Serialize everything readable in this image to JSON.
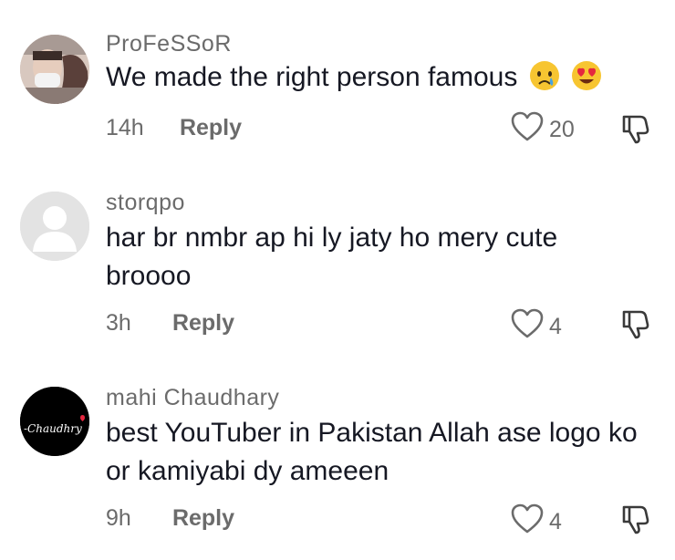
{
  "comments": [
    {
      "username": "ProFeSSoR",
      "text": "We made the right person famous",
      "emojis": [
        "crying-face",
        "heart-eyes-face"
      ],
      "time": "14h",
      "reply_label": "Reply",
      "likes": "20",
      "avatar": "photo"
    },
    {
      "username": "storqpo",
      "text": "har br nmbr ap hi ly jaty ho mery cute broooo",
      "time": "3h",
      "reply_label": "Reply",
      "likes": "4",
      "avatar": "default"
    },
    {
      "username": "mahi Chaudhary",
      "text": "best YouTuber in Pakistan Allah ase logo ko or kamiyabi dy ameeen",
      "time": "9h",
      "reply_label": "Reply",
      "likes": "4",
      "avatar": "logo",
      "avatar_text": "-Chaudhry"
    }
  ],
  "icons": {
    "like": "heart-outline-icon",
    "dislike": "thumbs-down-outline-icon"
  },
  "colors": {
    "secondary_text": "#6b6b6b",
    "primary_text": "#161823"
  }
}
